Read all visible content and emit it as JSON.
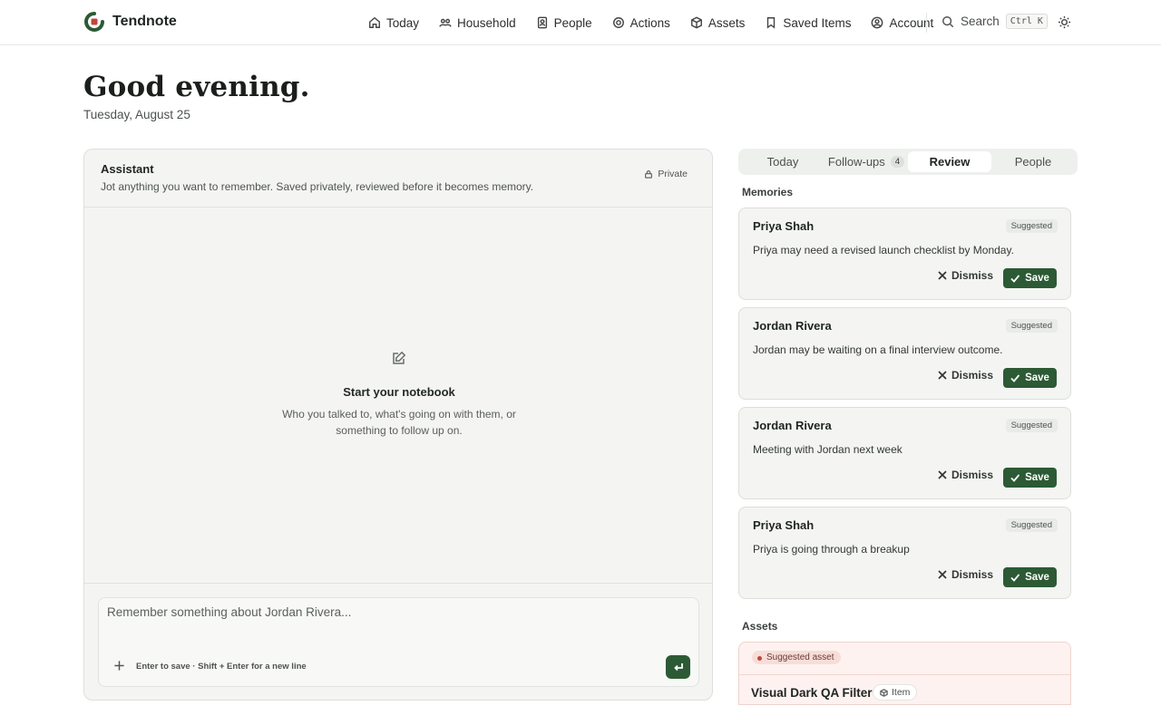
{
  "app": {
    "name": "Tendnote"
  },
  "nav": {
    "items": [
      {
        "label": "Today",
        "icon": "home-icon"
      },
      {
        "label": "Household",
        "icon": "household-icon"
      },
      {
        "label": "People",
        "icon": "contacts-icon"
      },
      {
        "label": "Actions",
        "icon": "target-icon"
      },
      {
        "label": "Assets",
        "icon": "box-icon"
      },
      {
        "label": "Saved Items",
        "icon": "bookmark-icon"
      },
      {
        "label": "Account",
        "icon": "account-icon"
      }
    ],
    "search_label": "Search",
    "search_shortcut": "Ctrl K"
  },
  "header": {
    "greeting": "Good evening.",
    "date": "Tuesday, August 25"
  },
  "assistant": {
    "title": "Assistant",
    "subtitle": "Jot anything you want to remember. Saved privately, reviewed before it becomes memory.",
    "privacy_label": "Private",
    "empty_title": "Start your notebook",
    "empty_subtitle": "Who you talked to, what's going on with them, or something to follow up on.",
    "input_placeholder": "Remember something about Jordan Rivera...",
    "input_value": "",
    "hint": "Enter to save · Shift + Enter for a new line"
  },
  "tabs": [
    {
      "label": "Today",
      "active": false
    },
    {
      "label": "Follow-ups",
      "badge": "4",
      "active": false
    },
    {
      "label": "Review",
      "active": true
    },
    {
      "label": "People",
      "active": false
    }
  ],
  "memories": {
    "label": "Memories",
    "items": [
      {
        "name": "Priya Shah",
        "badge": "Suggested",
        "text": "Priya may need a revised launch checklist by Monday.",
        "dismiss": "Dismiss",
        "save": "Save"
      },
      {
        "name": "Jordan Rivera",
        "badge": "Suggested",
        "text": "Jordan may be waiting on a final interview outcome.",
        "dismiss": "Dismiss",
        "save": "Save"
      },
      {
        "name": "Jordan Rivera",
        "badge": "Suggested",
        "text": "Meeting with Jordan next week",
        "dismiss": "Dismiss",
        "save": "Save"
      },
      {
        "name": "Priya Shah",
        "badge": "Suggested",
        "text": "Priya is going through a breakup",
        "dismiss": "Dismiss",
        "save": "Save"
      }
    ]
  },
  "assets": {
    "label": "Assets",
    "suggested_label": "Suggested asset",
    "title": "Visual Dark QA Filter",
    "type": "Item"
  },
  "colors": {
    "accent": "#2c5a35",
    "asset_bg": "#fdf2f0",
    "asset_dot": "#c0473a"
  }
}
